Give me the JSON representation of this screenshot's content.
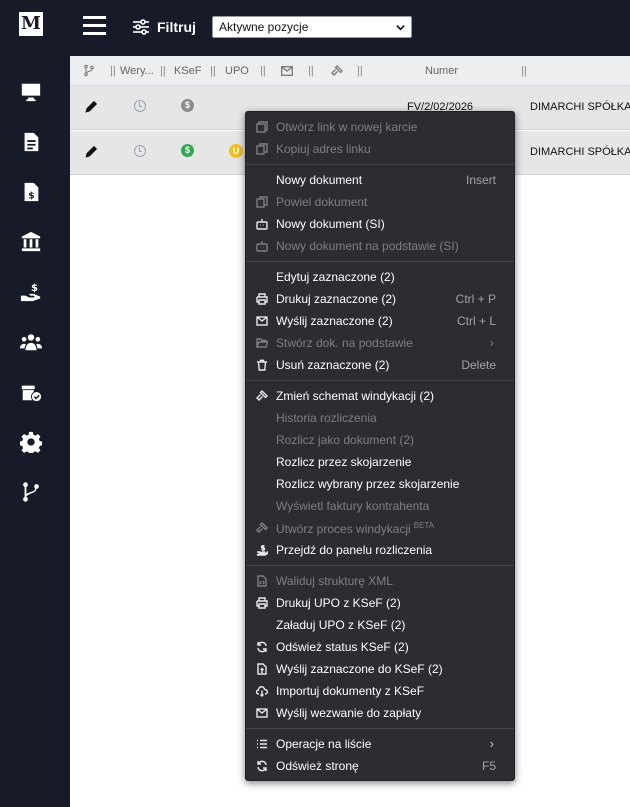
{
  "sidebar": {
    "logo": "M",
    "items": [
      {
        "name": "sidebar-item-dashboard",
        "icon": "monitor-icon"
      },
      {
        "name": "sidebar-item-documents",
        "icon": "document-list-icon"
      },
      {
        "name": "sidebar-item-invoices",
        "icon": "invoice-dollar-icon"
      },
      {
        "name": "sidebar-item-bank",
        "icon": "bank-icon"
      },
      {
        "name": "sidebar-item-payments",
        "icon": "hand-dollar-icon"
      },
      {
        "name": "sidebar-item-contractors",
        "icon": "users-icon"
      },
      {
        "name": "sidebar-item-warehouse",
        "icon": "box-check-icon"
      },
      {
        "name": "sidebar-item-settings",
        "icon": "gear-icon"
      },
      {
        "name": "sidebar-item-workflow",
        "icon": "branch-icon"
      }
    ]
  },
  "topbar": {
    "filter_label": "Filtruj",
    "select_value": "Aktywne pozycje"
  },
  "table": {
    "headers": {
      "col_weryfikacja": "Wery...",
      "col_ksef": "KSeF",
      "col_upo": "UPO",
      "col_numer": "Numer"
    },
    "rows": [
      {
        "numer": "FV/2/02/2026",
        "kontrahent": "DIMARCHI SPÓŁKA",
        "ksef_status": "pending"
      },
      {
        "numer": "",
        "kontrahent": "DIMARCHI SPÓŁKA",
        "ksef_status": "sent"
      }
    ]
  },
  "context_menu": {
    "items": [
      {
        "label": "Otwórz link w nowej karcie",
        "enabled": false,
        "icon": "open-new-tab-icon"
      },
      {
        "label": "Kopiuj adres linku",
        "enabled": false,
        "icon": "copy-icon"
      },
      {
        "label": "Nowy dokument",
        "shortcut": "Insert",
        "enabled": true
      },
      {
        "label": "Powiel dokument",
        "enabled": false,
        "icon": "copy-icon"
      },
      {
        "label": "Nowy dokument (SI)",
        "enabled": true,
        "icon": "robot-icon"
      },
      {
        "label": "Nowy dokument na podstawie (SI)",
        "enabled": false,
        "icon": "robot-icon"
      },
      {
        "label": "Edytuj zaznaczone (2)",
        "enabled": true
      },
      {
        "label": "Drukuj zaznaczone (2)",
        "shortcut": "Ctrl + P",
        "enabled": true,
        "icon": "printer-icon"
      },
      {
        "label": "Wyślij zaznaczone (2)",
        "shortcut": "Ctrl + L",
        "enabled": true,
        "icon": "envelope-icon"
      },
      {
        "label": "Stwórz dok. na podstawie",
        "enabled": false,
        "icon": "folder-open-icon",
        "submenu": true
      },
      {
        "label": "Usuń zaznaczone (2)",
        "shortcut": "Delete",
        "enabled": true,
        "icon": "trash-icon"
      },
      {
        "label": "Zmień schemat windykacji (2)",
        "enabled": true,
        "icon": "gavel-icon"
      },
      {
        "label": "Historia rozliczenia",
        "enabled": false
      },
      {
        "label": "Rozlicz jako dokument (2)",
        "enabled": false
      },
      {
        "label": "Rozlicz przez skojarzenie",
        "enabled": true
      },
      {
        "label": "Rozlicz wybrany przez skojarzenie",
        "enabled": true
      },
      {
        "label": "Wyświetl faktury kontrahenta",
        "enabled": false
      },
      {
        "label": "Utwórz proces windykacji",
        "beta": "BETA",
        "enabled": false,
        "icon": "gavel-icon"
      },
      {
        "label": "Przejdź do panelu rozliczenia",
        "enabled": true,
        "icon": "hand-dollar-icon"
      },
      {
        "label": "Waliduj strukturę XML",
        "enabled": false,
        "icon": "file-code-icon"
      },
      {
        "label": "Drukuj UPO z KSeF (2)",
        "enabled": true,
        "icon": "printer-icon"
      },
      {
        "label": "Załaduj UPO z KSeF (2)",
        "enabled": true
      },
      {
        "label": "Odśwież status KSeF (2)",
        "enabled": true,
        "icon": "refresh-icon"
      },
      {
        "label": "Wyślij zaznaczone do KSeF (2)",
        "enabled": true,
        "icon": "file-upload-icon"
      },
      {
        "label": "Importuj dokumenty z KSeF",
        "enabled": true,
        "icon": "cloud-download-icon"
      },
      {
        "label": "Wyślij wezwanie do zapłaty",
        "enabled": true,
        "icon": "envelope-icon"
      },
      {
        "label": "Operacje na liście",
        "enabled": true,
        "icon": "list-icon",
        "submenu": true
      },
      {
        "label": "Odśwież stronę",
        "shortcut": "F5",
        "enabled": true,
        "icon": "refresh-icon"
      }
    ],
    "submenu_glyph": "›"
  },
  "colors": {
    "sidebar_bg": "#171a28",
    "menu_bg": "#2b2d31",
    "ksef_pending": "#8c8c8c",
    "ksef_sent": "#2fa84f",
    "upo_badge": "#f2c01d"
  }
}
